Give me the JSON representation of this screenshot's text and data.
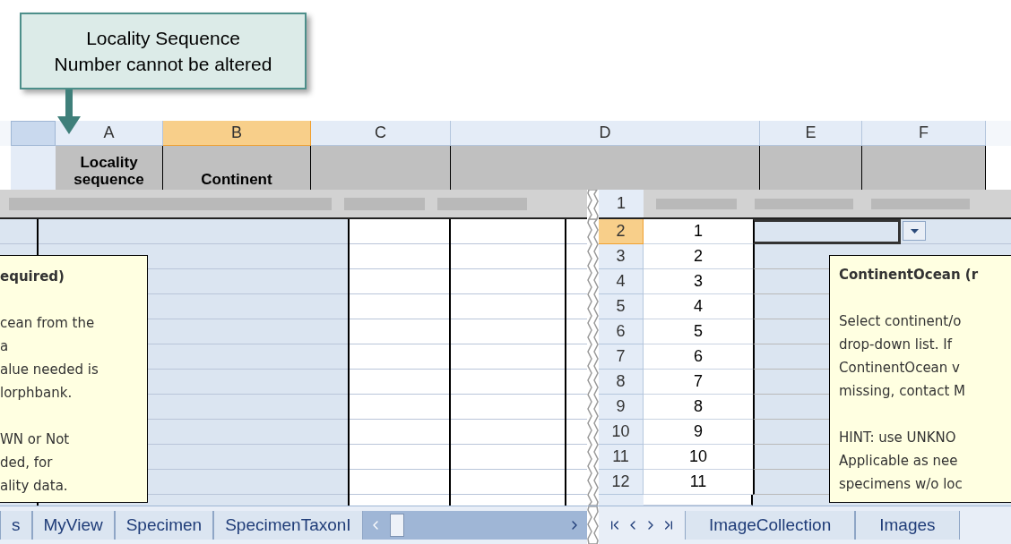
{
  "callout": {
    "lines": [
      "Locality Sequence",
      "Number cannot be altered"
    ]
  },
  "columns": [
    {
      "letter": "A",
      "selected": false,
      "header": "Locality sequence"
    },
    {
      "letter": "B",
      "selected": true,
      "header": "Continent"
    },
    {
      "letter": "C",
      "selected": false
    },
    {
      "letter": "D",
      "selected": false
    },
    {
      "letter": "E",
      "selected": false
    },
    {
      "letter": "F",
      "selected": false
    }
  ],
  "strip_row": "1",
  "left_tooltip": {
    "title": "equired)",
    "paragraphs": [
      [
        "cean from the",
        "a",
        "alue needed is",
        "lorphbank."
      ],
      [
        "WN or Not",
        "ded, for",
        "ality data."
      ]
    ]
  },
  "rows": [
    {
      "row": "2",
      "value": "1",
      "selected": true
    },
    {
      "row": "3",
      "value": "2",
      "selected": false
    },
    {
      "row": "4",
      "value": "3",
      "selected": false
    },
    {
      "row": "5",
      "value": "4",
      "selected": false
    },
    {
      "row": "6",
      "value": "5",
      "selected": false
    },
    {
      "row": "7",
      "value": "6",
      "selected": false
    },
    {
      "row": "8",
      "value": "7",
      "selected": false
    },
    {
      "row": "9",
      "value": "8",
      "selected": false
    },
    {
      "row": "10",
      "value": "9",
      "selected": false
    },
    {
      "row": "11",
      "value": "10",
      "selected": false
    },
    {
      "row": "12",
      "value": "11",
      "selected": false
    }
  ],
  "right_tooltip": {
    "title": "ContinentOcean (r",
    "paragraphs": [
      [
        "Select continent/o",
        "drop-down list. If",
        "ContinentOcean v",
        "missing, contact M"
      ],
      [
        "HINT: use UNKNO",
        "Applicable as nee",
        "specimens w/o loc"
      ]
    ]
  },
  "sheet_tabs_left": [
    "s",
    "MyView",
    "Specimen",
    "SpecimenTaxonI"
  ],
  "sheet_tabs_right": [
    "ImageCollection",
    "Images"
  ]
}
